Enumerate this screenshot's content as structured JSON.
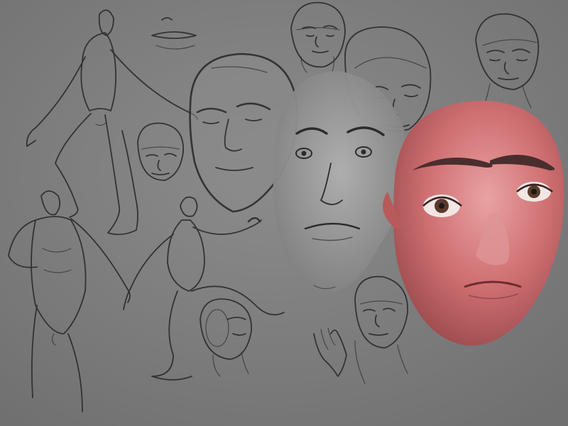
{
  "artwork": {
    "colors": {
      "paper": "#7c7c7c",
      "pencil": "#2b2b2b",
      "gray_face": "#8d8d8d",
      "gray_face_light": "#a7a7a7",
      "skin_base": "#cf6f72",
      "skin_light": "#e69b9c",
      "skin_dark": "#9b4b4d"
    }
  }
}
